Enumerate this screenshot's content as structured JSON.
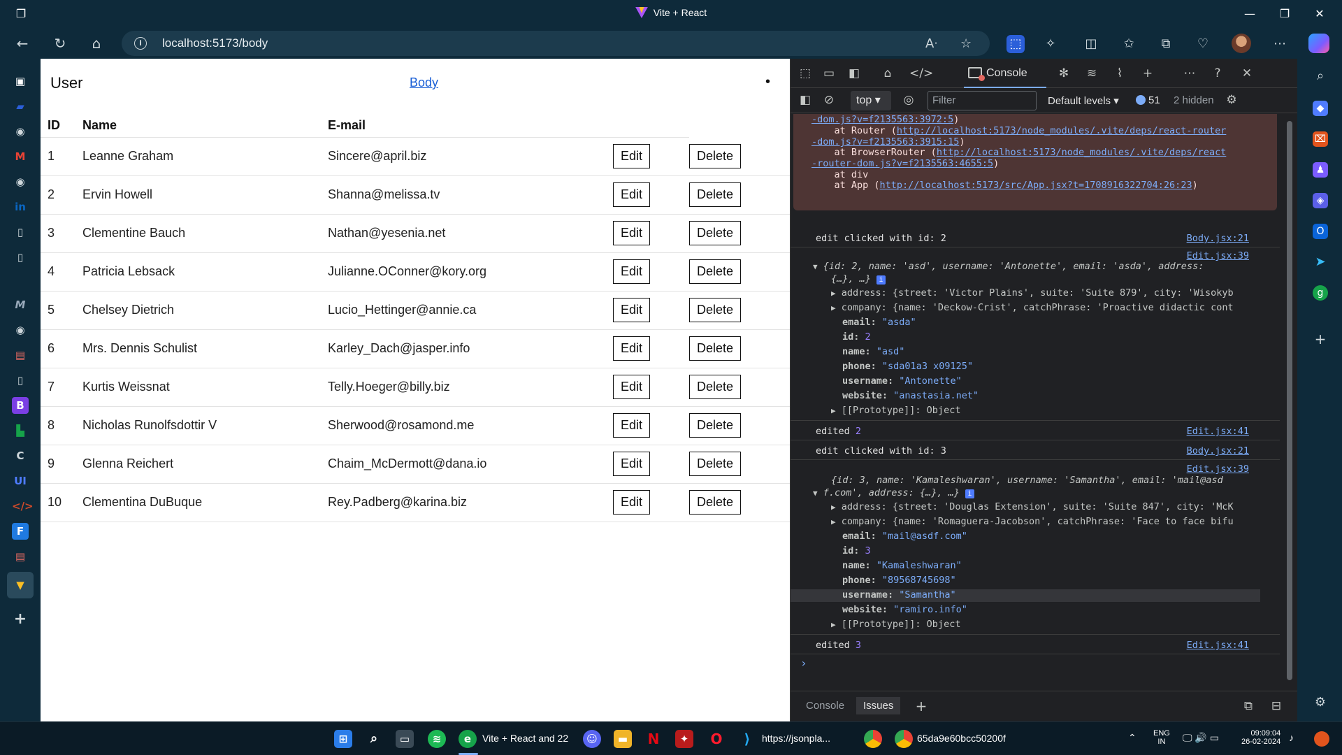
{
  "browser": {
    "window_title": "Vite + React",
    "url": "localhost:5173/body"
  },
  "page": {
    "brand": "User",
    "nav_link": "Body",
    "dot": "•",
    "headers": [
      "ID",
      "Name",
      "E-mail"
    ],
    "edit_label": "Edit",
    "delete_label": "Delete",
    "rows": [
      {
        "id": "1",
        "name": "Leanne Graham",
        "email": "Sincere@april.biz"
      },
      {
        "id": "2",
        "name": "Ervin Howell",
        "email": "Shanna@melissa.tv"
      },
      {
        "id": "3",
        "name": "Clementine Bauch",
        "email": "Nathan@yesenia.net"
      },
      {
        "id": "4",
        "name": "Patricia Lebsack",
        "email": "Julianne.OConner@kory.org"
      },
      {
        "id": "5",
        "name": "Chelsey Dietrich",
        "email": "Lucio_Hettinger@annie.ca"
      },
      {
        "id": "6",
        "name": "Mrs. Dennis Schulist",
        "email": "Karley_Dach@jasper.info"
      },
      {
        "id": "7",
        "name": "Kurtis Weissnat",
        "email": "Telly.Hoeger@billy.biz"
      },
      {
        "id": "8",
        "name": "Nicholas Runolfsdottir V",
        "email": "Sherwood@rosamond.me"
      },
      {
        "id": "9",
        "name": "Glenna Reichert",
        "email": "Chaim_McDermott@dana.io"
      },
      {
        "id": "10",
        "name": "Clementina DuBuque",
        "email": "Rey.Padberg@karina.biz"
      }
    ]
  },
  "devtools": {
    "console_tab": "Console",
    "context": "top",
    "filter_placeholder": "Filter",
    "levels": "Default levels",
    "issues_count": "51",
    "hidden": "2 hidden",
    "error_lines": {
      "l1_link": "-dom.js?v=f2135563:3972:5",
      "l1_tail": ")",
      "l2_pre": "    at Router (",
      "l2_link": "http://localhost:5173/node_modules/.vite/deps/react-router",
      "l3_link": "-dom.js?v=f2135563:3915:15",
      "l3_tail": ")",
      "l4_pre": "    at BrowserRouter (",
      "l4_link": "http://localhost:5173/node_modules/.vite/deps/react",
      "l5_link": "-router-dom.js?v=f2135563:4655:5",
      "l5_tail": ")",
      "l6": "    at div",
      "l7_pre": "    at App (",
      "l7_link": "http://localhost:5173/src/App.jsx?t=1708916322704:26:23",
      "l7_tail": ")"
    },
    "log1": {
      "text": "edit clicked with id: 2",
      "src": "Body.jsx:21"
    },
    "obj1": {
      "src": "Edit.jsx:39",
      "summary_a": "{id: 2, name: 'asd', username: 'Antonette', email: 'asda', address:",
      "summary_b": "{…}, …}",
      "address": "address: {street: 'Victor Plains', suite: 'Suite 879', city: 'Wisokyb",
      "company": "company: {name: 'Deckow-Crist', catchPhrase: 'Proactive didactic cont",
      "email_k": "email:",
      "email_v": "\"asda\"",
      "id_k": "id:",
      "id_v": "2",
      "name_k": "name:",
      "name_v": "\"asd\"",
      "phone_k": "phone:",
      "phone_v": "\"sda01a3 x09125\"",
      "username_k": "username:",
      "username_v": "\"Antonette\"",
      "website_k": "website:",
      "website_v": "\"anastasia.net\"",
      "proto": "[[Prototype]]: Object"
    },
    "edited1": {
      "label": "edited",
      "num": "2",
      "src": "Edit.jsx:41"
    },
    "log2": {
      "text": "edit clicked with id: 3",
      "src": "Body.jsx:21"
    },
    "obj2": {
      "src": "Edit.jsx:39",
      "summary_a": "{id: 3, name: 'Kamaleshwaran', username: 'Samantha', email: 'mail@asd",
      "summary_b": "f.com', address: {…}, …}",
      "address": "address: {street: 'Douglas Extension', suite: 'Suite 847', city: 'McK",
      "company": "company: {name: 'Romaguera-Jacobson', catchPhrase: 'Face to face bifu",
      "email_k": "email:",
      "email_v": "\"mail@asdf.com\"",
      "id_k": "id:",
      "id_v": "3",
      "name_k": "name:",
      "name_v": "\"Kamaleshwaran\"",
      "phone_k": "phone:",
      "phone_v": "\"89568745698\"",
      "username_k": "username:",
      "username_v": "\"Samantha\"",
      "website_k": "website:",
      "website_v": "\"ramiro.info\"",
      "proto": "[[Prototype]]: Object"
    },
    "edited2": {
      "label": "edited",
      "num": "3",
      "src": "Edit.jsx:41"
    },
    "drawer_console": "Console",
    "drawer_issues": "Issues"
  },
  "taskbar": {
    "edge_label": "Vite + React and 22",
    "chrome_label": "https://jsonpla...",
    "chrome2_label": "65da9e60bcc50200f",
    "lang_top": "ENG",
    "lang_bottom": "IN",
    "time": "09:09:04",
    "date": "26-02-2024"
  }
}
